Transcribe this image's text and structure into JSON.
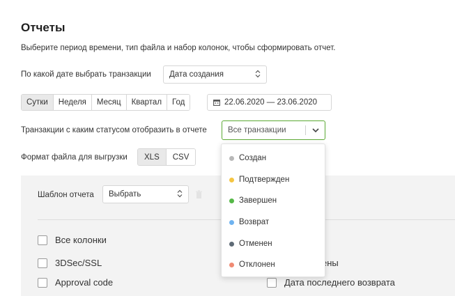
{
  "page": {
    "title": "Отчеты",
    "subtitle": "Выберите период времени, тип файла и набор колонок, чтобы сформировать отчет."
  },
  "date_by": {
    "label": "По какой дате выбрать транзакции",
    "value": "Дата создания"
  },
  "periods": {
    "items": [
      {
        "label": "Сутки",
        "active": true
      },
      {
        "label": "Неделя",
        "active": false
      },
      {
        "label": "Месяц",
        "active": false
      },
      {
        "label": "Квартал",
        "active": false
      },
      {
        "label": "Год",
        "active": false
      }
    ],
    "date_range": "22.06.2020 — 23.06.2020"
  },
  "status": {
    "label": "Транзакции с каким статусом отобразить в отчете",
    "value": "Все транзакции",
    "options": [
      {
        "label": "Создан",
        "color": "#b8b8b8"
      },
      {
        "label": "Подтвержден",
        "color": "#f5c542"
      },
      {
        "label": "Завершен",
        "color": "#55b847"
      },
      {
        "label": "Возврат",
        "color": "#6fb3f0"
      },
      {
        "label": "Отменен",
        "color": "#5f6b76"
      },
      {
        "label": "Отклонен",
        "color": "#f08a73"
      }
    ]
  },
  "format": {
    "label": "Формат файла для выгрузки",
    "options": [
      {
        "label": "XLS",
        "active": true
      },
      {
        "label": "CSV",
        "active": false
      }
    ]
  },
  "template": {
    "label": "Шаблон отчета",
    "value": "Выбрать"
  },
  "columns": {
    "all": "Все колонки",
    "left": [
      "3DSec/SSL",
      "Approval code"
    ],
    "right": [
      "ены",
      "Дата последнего возврата"
    ]
  },
  "colors": {
    "accent": "#5aa832",
    "panel_bg": "#f3f3f3"
  }
}
